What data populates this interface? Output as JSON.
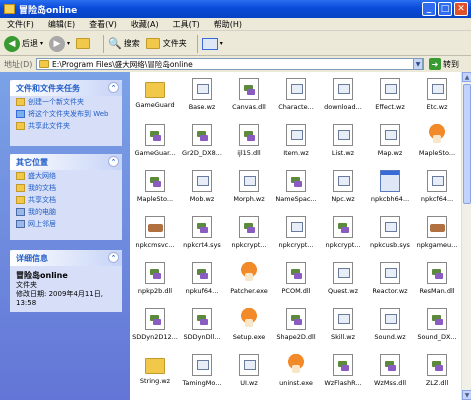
{
  "window": {
    "title": "冒险岛online"
  },
  "menubar": {
    "items": [
      "文件(F)",
      "编辑(E)",
      "查看(V)",
      "收藏(A)",
      "工具(T)",
      "帮助(H)"
    ]
  },
  "toolbar": {
    "back": "后退",
    "search": "搜索",
    "folders": "文件夹"
  },
  "address": {
    "label": "地址(D)",
    "path": "E:\\Program Files\\盛大网络\\冒险岛online",
    "go": "转到"
  },
  "file_tasks": {
    "title": "文件和文件夹任务",
    "items": [
      "创建一个新文件夹",
      "将这个文件夹发布到 Web",
      "共享此文件夹"
    ]
  },
  "other_places": {
    "title": "其它位置",
    "items": [
      "盛大网络",
      "我的文档",
      "共享文档",
      "我的电脑",
      "网上邻居"
    ]
  },
  "details": {
    "title": "详细信息",
    "name": "冒险岛online",
    "type": "文件夹",
    "modified": "修改日期: 2009年4月11日, 13:58"
  },
  "files": [
    {
      "name": "GameGuard",
      "kind": "folder"
    },
    {
      "name": "Base.wz",
      "kind": "doc"
    },
    {
      "name": "Canvas.dll",
      "kind": "dll"
    },
    {
      "name": "Characte...",
      "kind": "doc"
    },
    {
      "name": "download...",
      "kind": "doc"
    },
    {
      "name": "Effect.wz",
      "kind": "doc"
    },
    {
      "name": "Etc.wz",
      "kind": "doc"
    },
    {
      "name": "GameGuar...",
      "kind": "dll"
    },
    {
      "name": "Gr2D_DX8...",
      "kind": "dll"
    },
    {
      "name": "ijl15.dll",
      "kind": "dll"
    },
    {
      "name": "Item.wz",
      "kind": "doc"
    },
    {
      "name": "List.wz",
      "kind": "doc"
    },
    {
      "name": "Map.wz",
      "kind": "doc"
    },
    {
      "name": "MapleSto...",
      "kind": "mush"
    },
    {
      "name": "MapleSto...",
      "kind": "dll"
    },
    {
      "name": "Mob.wz",
      "kind": "doc"
    },
    {
      "name": "Morph.wz",
      "kind": "doc"
    },
    {
      "name": "NameSpac...",
      "kind": "dll"
    },
    {
      "name": "Npc.wz",
      "kind": "doc"
    },
    {
      "name": "npkcbh64...",
      "kind": "win"
    },
    {
      "name": "npkcf64...",
      "kind": "doc"
    },
    {
      "name": "npkcmsvc...",
      "kind": "kbd"
    },
    {
      "name": "npkcrt4.sys",
      "kind": "dll"
    },
    {
      "name": "npkcrypt...",
      "kind": "dll"
    },
    {
      "name": "npkcrypt...",
      "kind": "doc"
    },
    {
      "name": "npkcrypt...",
      "kind": "dll"
    },
    {
      "name": "npkcusb.sys",
      "kind": "doc"
    },
    {
      "name": "npkgameu...",
      "kind": "kbd"
    },
    {
      "name": "npkp2b.dll",
      "kind": "dll"
    },
    {
      "name": "npkuf64...",
      "kind": "dll"
    },
    {
      "name": "Patcher.exe",
      "kind": "mush"
    },
    {
      "name": "PCOM.dll",
      "kind": "dll"
    },
    {
      "name": "Quest.wz",
      "kind": "doc"
    },
    {
      "name": "Reactor.wz",
      "kind": "doc"
    },
    {
      "name": "ResMan.dll",
      "kind": "dll"
    },
    {
      "name": "SDDyn2D12...",
      "kind": "dll"
    },
    {
      "name": "SDDynDll...",
      "kind": "dll"
    },
    {
      "name": "Setup.exe",
      "kind": "mush"
    },
    {
      "name": "Shape2D.dll",
      "kind": "dll"
    },
    {
      "name": "Skill.wz",
      "kind": "doc"
    },
    {
      "name": "Sound.wz",
      "kind": "doc"
    },
    {
      "name": "Sound_DX...",
      "kind": "dll"
    },
    {
      "name": "String.wz",
      "kind": "folder"
    },
    {
      "name": "TamingMo...",
      "kind": "doc"
    },
    {
      "name": "UI.wz",
      "kind": "doc"
    },
    {
      "name": "uninst.exe",
      "kind": "mush"
    },
    {
      "name": "WzFlashR...",
      "kind": "dll"
    },
    {
      "name": "WzMss.dll",
      "kind": "dll"
    },
    {
      "name": "ZLZ.dll",
      "kind": "dll"
    }
  ]
}
